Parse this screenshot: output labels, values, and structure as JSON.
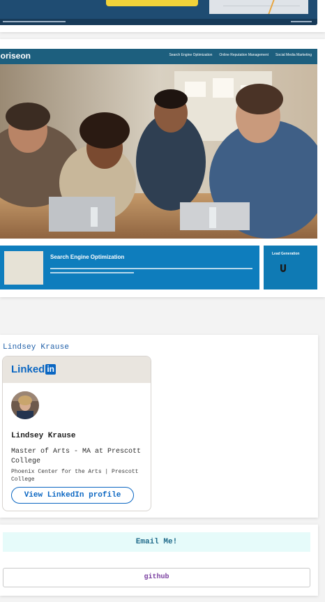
{
  "horiseon": {
    "logo": "Horiseon",
    "nav": [
      "Search Engine Optimization",
      "Online Reputation Management",
      "Social Media Marketing"
    ],
    "seo_title": "Search Engine Optimization",
    "lead_title": "Lead Generation"
  },
  "profile": {
    "name_link": "Lindsey Krause",
    "linkedin_logo": "Linked",
    "linkedin_logo_in": "in",
    "name": "Lindsey Krause",
    "headline": "Master of Arts - MA at Prescott College",
    "company": "Phoenix Center for the Arts | Prescott College",
    "view_button": "View LinkedIn profile"
  },
  "contact": {
    "email_button": "Email Me!",
    "github_button": "github"
  },
  "colors": {
    "linkedin_blue": "#0a66c2",
    "email_bg": "#e6fbfa",
    "github_text": "#7a3fa0"
  }
}
